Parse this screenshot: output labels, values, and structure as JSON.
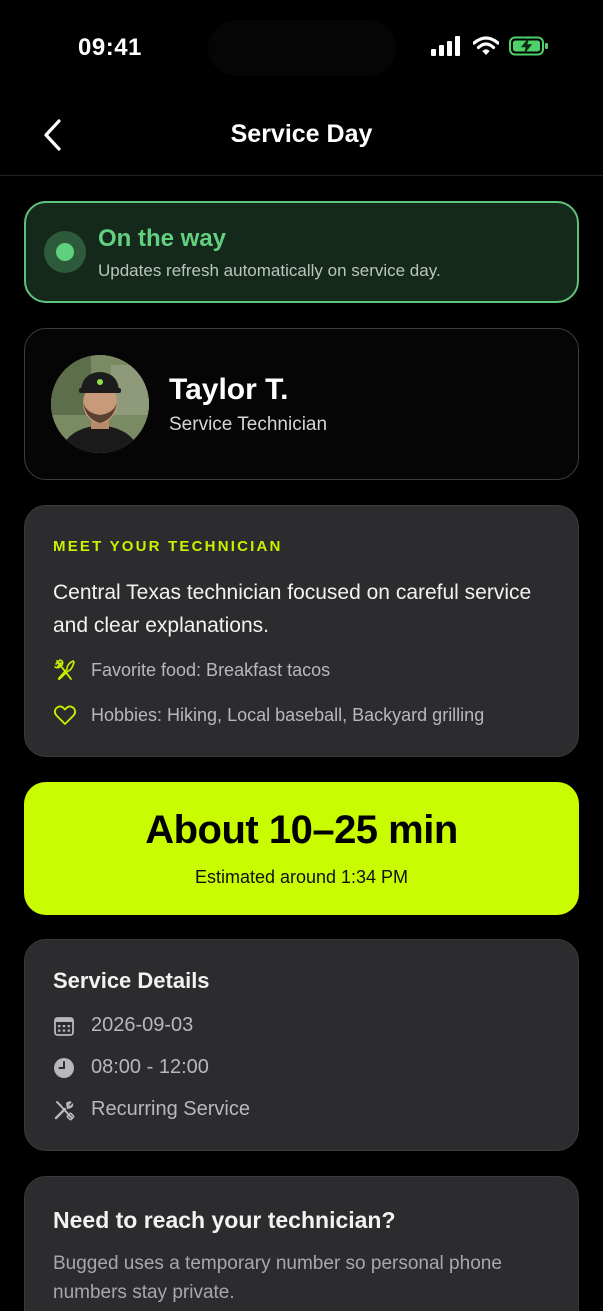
{
  "status_bar": {
    "time": "09:41"
  },
  "nav": {
    "title": "Service Day"
  },
  "status": {
    "title": "On the way",
    "subtitle": "Updates refresh automatically on service day.",
    "color": "#62d07f"
  },
  "technician": {
    "name": "Taylor T.",
    "role": "Service Technician"
  },
  "meet": {
    "label": "MEET YOUR TECHNICIAN",
    "description": "Central Texas technician focused on careful service and clear explanations.",
    "food": "Favorite food: Breakfast tacos",
    "hobbies": "Hobbies: Hiking, Local baseball, Backyard grilling",
    "accent": "#c8f200"
  },
  "eta": {
    "title": "About 10–25 min",
    "subtitle": "Estimated around 1:34 PM",
    "color": "#c9fc00"
  },
  "details": {
    "title": "Service Details",
    "date": "2026-09-03",
    "hours": "08:00 - 12:00",
    "type": "Recurring Service"
  },
  "reach": {
    "title": "Need to reach your technician?",
    "description": "Bugged uses a temporary number so personal phone numbers stay private."
  },
  "icons": [
    "back-chevron-icon",
    "cellular-signal-icon",
    "wifi-icon",
    "battery-charging-icon",
    "fork-knife-icon",
    "heart-icon",
    "calendar-icon",
    "clock-icon",
    "tools-icon"
  ]
}
